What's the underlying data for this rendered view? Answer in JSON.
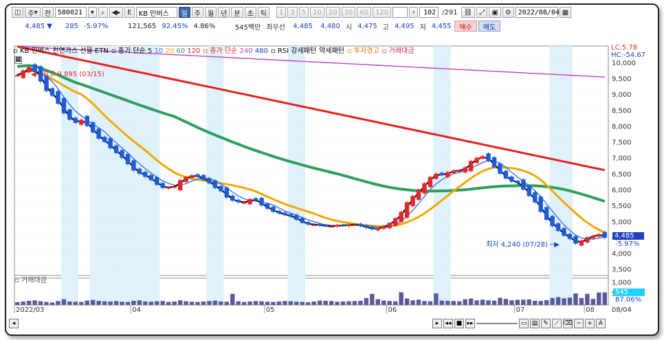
{
  "toolbar": {
    "period_items": [
      "주",
      "전"
    ],
    "code": "580021",
    "etf_badge": "E",
    "name": "KB 인버스",
    "period_buttons": [
      "일",
      "주",
      "월",
      "년",
      "분",
      "초",
      "틱"
    ],
    "selected_period": "일",
    "interval_buttons": [
      "1",
      "3",
      "5",
      "10",
      "20",
      "30",
      "60",
      "120"
    ],
    "count": "102",
    "total": "/291",
    "date": "2022/08/04"
  },
  "quote": {
    "price": "4,485",
    "change": "285",
    "change_pct": "-5.97%",
    "volume": "121,565",
    "ratio": "92.45%",
    "turnover": "4.86%",
    "amount": "545백만",
    "best_label": "최우선",
    "best_ask": "4,485",
    "best_bid": "4,480",
    "open_label": "시",
    "open": "4,475",
    "high_label": "고",
    "high": "4,495",
    "low_label": "저",
    "low": "4,455",
    "buy_label": "매수",
    "sell_label": "매도"
  },
  "legend": {
    "title": "KB 인버스 천연가스 선물 ETN",
    "ma_label": "종가 단순",
    "ma5": "5",
    "ma10": "10",
    "ma20": "20",
    "ma60": "60",
    "ma120": "120",
    "ma2_label": "종가 단순",
    "ma240": "240",
    "ma480": "480",
    "rsi": "RSI 강세패턴",
    "weak": "약세패턴",
    "warn": "투자경고",
    "volume": "거래대금"
  },
  "annotations": {
    "high": "최고 9,895 (03/15)",
    "low": "최저 4,240 (07/28)",
    "lc": "LC:5.78",
    "hc": "HC:-54.67",
    "cur_price": "4,485",
    "cur_pct": "-5.97%",
    "vol_value": "545",
    "vol_pct": "87.06%",
    "volume_panel_title": "거래대금"
  },
  "price_axis": [
    "10,000",
    "9,500",
    "9,000",
    "8,500",
    "8,000",
    "7,500",
    "7,000",
    "6,500",
    "6,000",
    "5,500",
    "5,000",
    "4,500",
    "4,000",
    "3,500"
  ],
  "volume_axis": [
    "1,000",
    "500"
  ],
  "time_axis": [
    "2022/03",
    "04",
    "05",
    "06",
    "07",
    "08",
    "08/04"
  ],
  "colors": {
    "up": "#e0262a",
    "down": "#1f5bd6",
    "ma5": "#111111",
    "ma10": "#3a6fe8",
    "ma20": "#f0a800",
    "ma60": "#2e9e5e",
    "ma120": "#e82020",
    "ma240": "#c040c8",
    "volume": "#5a5a9a",
    "shade": "#dff2fb"
  },
  "chart_data": {
    "type": "candlestick",
    "ylim": [
      3300,
      10300
    ],
    "y_ticks": [
      10000,
      9500,
      9000,
      8500,
      8000,
      7500,
      7000,
      6500,
      6000,
      5500,
      5000,
      4500,
      4000,
      3500
    ],
    "closes": [
      9600,
      9750,
      9850,
      9700,
      9400,
      9100,
      8950,
      8700,
      8400,
      8200,
      8100,
      8200,
      8000,
      7800,
      7600,
      7500,
      7300,
      7150,
      7000,
      6800,
      6600,
      6500,
      6400,
      6300,
      6150,
      6050,
      6080,
      6100,
      6300,
      6400,
      6450,
      6400,
      6300,
      6200,
      6050,
      5950,
      5750,
      5650,
      5600,
      5600,
      5700,
      5650,
      5500,
      5400,
      5300,
      5250,
      5200,
      5150,
      5050,
      4950,
      4900,
      4900,
      4870,
      4850,
      4850,
      4880,
      4870,
      4900,
      4900,
      4850,
      4800,
      4750,
      4800,
      4850,
      4950,
      5100,
      5300,
      5600,
      5800,
      6000,
      6200,
      6400,
      6500,
      6450,
      6550,
      6600,
      6600,
      6700,
      6900,
      7000,
      7050,
      6900,
      6700,
      6500,
      6350,
      6250,
      6200,
      6000,
      5800,
      5600,
      5300,
      5050,
      4850,
      4700,
      4550,
      4450,
      4300,
      4400,
      4500,
      4550,
      4600,
      4485
    ],
    "volumes": [
      120,
      150,
      180,
      200,
      160,
      130,
      110,
      170,
      250,
      150,
      140,
      130,
      190,
      220,
      180,
      160,
      150,
      170,
      140,
      130,
      180,
      200,
      150,
      140,
      160,
      170,
      130,
      150,
      200,
      160,
      140,
      130,
      150,
      170,
      190,
      150,
      140,
      480,
      160,
      130,
      150,
      170,
      160,
      140,
      130,
      150,
      170,
      160,
      140,
      130,
      120,
      150,
      190,
      180,
      170,
      140,
      150,
      160,
      170,
      180,
      300,
      480,
      250,
      190,
      170,
      160,
      550,
      280,
      200,
      230,
      170,
      160,
      500,
      190,
      180,
      170,
      160,
      250,
      280,
      200,
      230,
      200,
      190,
      310,
      260,
      200,
      220,
      230,
      240,
      180,
      170,
      210,
      300,
      340,
      290,
      320,
      500,
      300,
      480,
      260,
      540,
      545
    ],
    "ma_series": [
      {
        "name": "5"
      },
      {
        "name": "10"
      },
      {
        "name": "20"
      },
      {
        "name": "60"
      },
      {
        "name": "120"
      },
      {
        "name": "240"
      }
    ]
  }
}
